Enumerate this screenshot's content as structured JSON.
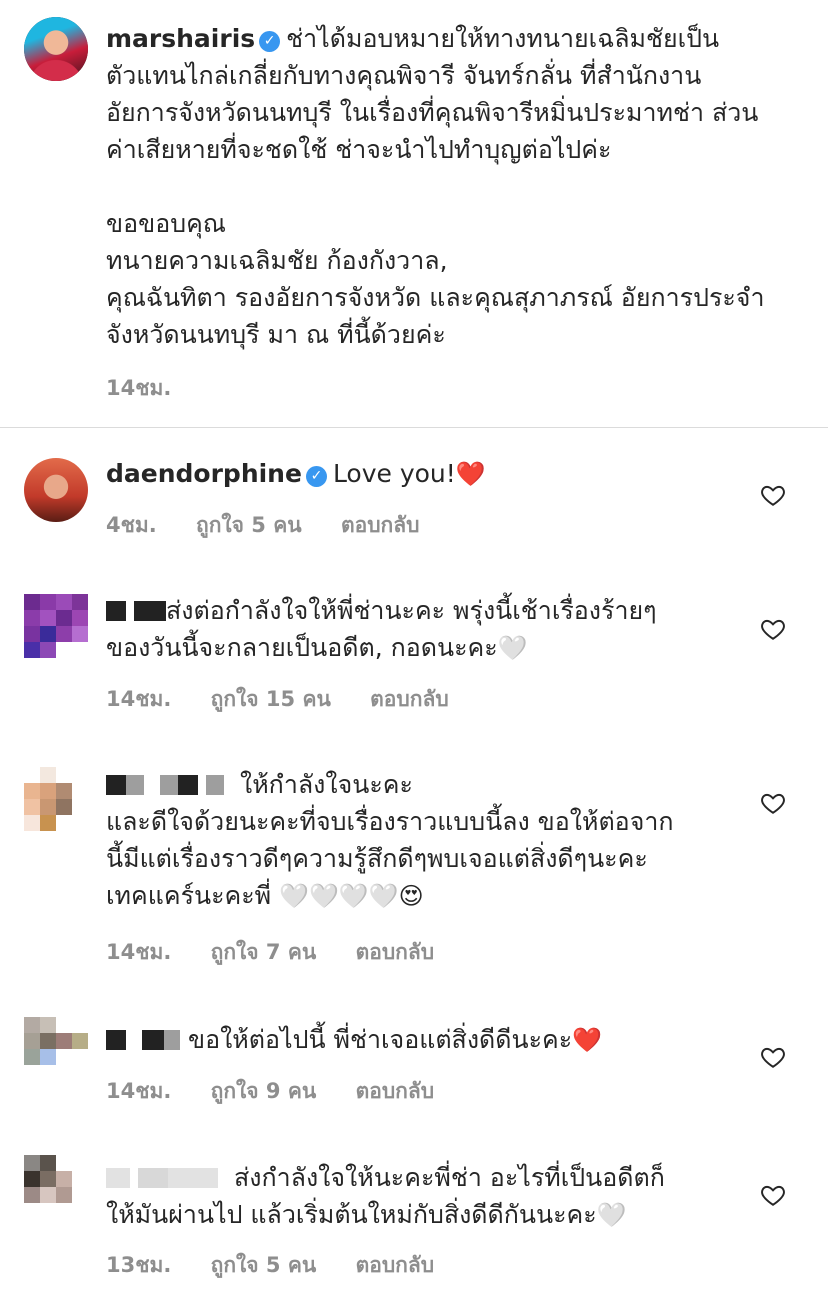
{
  "post": {
    "username": "marshairis",
    "caption_lines": [
      "ช่าได้มอบหมายให้ทางทนายเฉลิมชัยเป็น",
      "ตัวแทนไกล่เกลี่ยกับทางคุณพิจารี จันทร์กลั่น ที่สำนักงาน",
      "อัยการจังหวัดนนทบุรี ในเรื่องที่คุณพิจารีหมิ่นประมาทช่า ส่วน",
      "ค่าเสียหายที่จะชดใช้ ช่าจะนำไปทำบุญต่อไปค่ะ",
      "",
      "ขอขอบคุณ",
      "ทนายความเฉลิมชัย ก้องกังวาล,",
      "คุณฉันทิตา รองอัยการจังหวัด และคุณสุภาภรณ์ อัยการประจำ",
      "จังหวัดนนทบุรี มา ณ ที่นี้ด้วยค่ะ"
    ],
    "time": "14ชม."
  },
  "comments": [
    {
      "username": "daendorphine",
      "text": "Love you!",
      "emoji": "❤️",
      "time": "4ชม.",
      "likes": "ถูกใจ 5 คน",
      "reply": "ตอบกลับ"
    },
    {
      "text_lines": [
        "ส่งต่อกำลังใจให้พี่ช่านะคะ พรุ่งนี้เช้าเรื่องร้ายๆ",
        "ของวันนี้จะกลายเป็นอดีต, กอดนะคะ"
      ],
      "emoji": "🤍",
      "time": "14ชม.",
      "likes": "ถูกใจ 15 คน",
      "reply": "ตอบกลับ"
    },
    {
      "text_lines": [
        "ให้กำลังใจนะคะ",
        "และดีใจด้วยนะคะที่จบเรื่องราวแบบนี้ลง ขอให้ต่อจาก",
        "นี้มีแต่เรื่องราวดีๆความรู้สึกดีๆพบเจอแต่สิ่งดีๆนะคะ",
        "เทคแคร์นะคะพี่"
      ],
      "emoji": "🤍🤍🤍🤍😍",
      "time": "14ชม.",
      "likes": "ถูกใจ 7 คน",
      "reply": "ตอบกลับ"
    },
    {
      "text_lines": [
        "ขอให้ต่อไปนี้ พี่ช่าเจอแต่สิ่งดีดีนะคะ"
      ],
      "emoji": "❤️",
      "time": "14ชม.",
      "likes": "ถูกใจ 9 คน",
      "reply": "ตอบกลับ"
    },
    {
      "text_lines": [
        "ส่งกำลังใจให้นะคะพี่ช่า อะไรที่เป็นอดีตก็",
        "ให้มันผ่านไป แล้วเริ่มต้นใหม่กับสิ่งดีดีกันนะคะ"
      ],
      "emoji": "🤍",
      "time": "13ชม.",
      "likes": "ถูกใจ 5 คน",
      "reply": "ตอบกลับ"
    }
  ],
  "icons": {
    "verified": "verified-badge-icon",
    "like": "heart-outline-icon"
  },
  "colors": {
    "text": "#262626",
    "meta": "#8e8e8e",
    "verified": "#3897f0",
    "divider": "#dbdbdb"
  }
}
